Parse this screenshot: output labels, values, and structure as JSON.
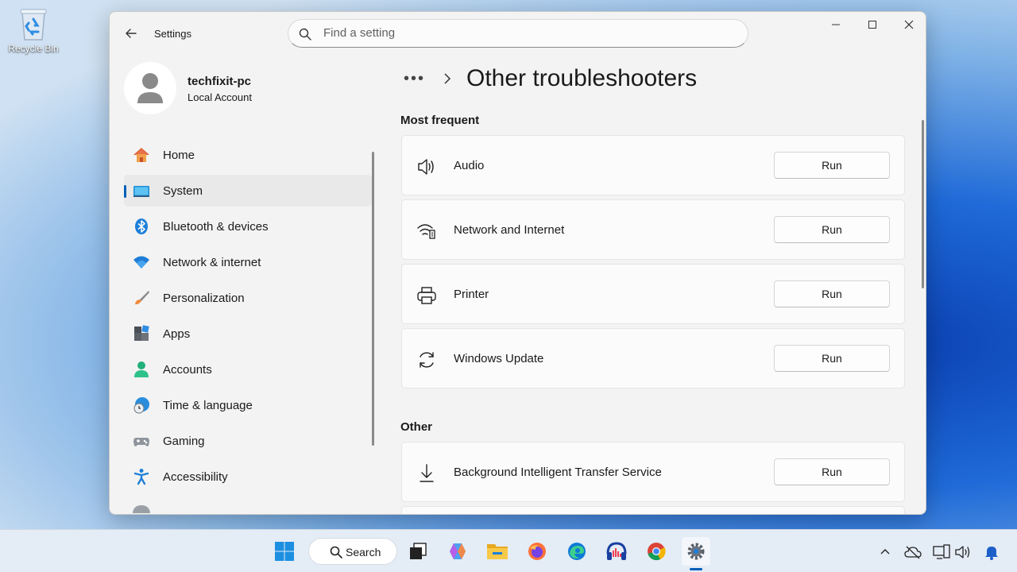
{
  "desktop": {
    "recycle_bin_label": "Recycle Bin"
  },
  "window": {
    "title": "Settings",
    "search_placeholder": "Find a setting",
    "profile": {
      "name": "techfixit-pc",
      "account_type": "Local Account"
    },
    "nav": [
      {
        "label": "Home",
        "icon": "home-icon"
      },
      {
        "label": "System",
        "icon": "system-icon",
        "selected": true
      },
      {
        "label": "Bluetooth & devices",
        "icon": "bluetooth-icon"
      },
      {
        "label": "Network & internet",
        "icon": "wifi-icon"
      },
      {
        "label": "Personalization",
        "icon": "brush-icon"
      },
      {
        "label": "Apps",
        "icon": "apps-icon"
      },
      {
        "label": "Accounts",
        "icon": "accounts-icon"
      },
      {
        "label": "Time & language",
        "icon": "clock-globe-icon"
      },
      {
        "label": "Gaming",
        "icon": "gamepad-icon"
      },
      {
        "label": "Accessibility",
        "icon": "accessibility-icon"
      }
    ],
    "breadcrumb": {
      "ellipsis": "•••",
      "page_title": "Other troubleshooters"
    },
    "sections": {
      "most_frequent": {
        "heading": "Most frequent",
        "items": [
          {
            "label": "Audio",
            "icon": "speaker-icon",
            "button": "Run"
          },
          {
            "label": "Network and Internet",
            "icon": "network-icon",
            "button": "Run"
          },
          {
            "label": "Printer",
            "icon": "printer-icon",
            "button": "Run"
          },
          {
            "label": "Windows Update",
            "icon": "sync-icon",
            "button": "Run"
          }
        ]
      },
      "other": {
        "heading": "Other",
        "items": [
          {
            "label": "Background Intelligent Transfer Service",
            "icon": "download-icon",
            "button": "Run"
          }
        ]
      }
    }
  },
  "taskbar": {
    "search_label": "Search",
    "apps": [
      "start-icon",
      "task-view-icon",
      "copilot-icon",
      "file-explorer-icon",
      "firefox-icon",
      "edge-icon",
      "audio-app-icon",
      "chrome-icon",
      "settings-icon"
    ],
    "tray": [
      "chevron-up-icon",
      "onedrive-offline-icon",
      "display-icon",
      "volume-icon",
      "notification-bell-icon"
    ]
  },
  "colors": {
    "accent": "#005fb8",
    "window_bg": "#f3f3f3",
    "card_bg": "#fbfbfb"
  }
}
